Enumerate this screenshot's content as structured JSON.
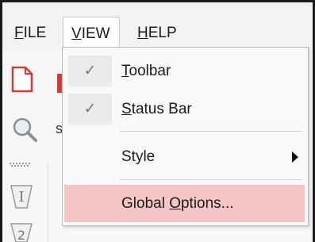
{
  "menubar": {
    "file": {
      "pre": "",
      "u": "F",
      "post": "ILE"
    },
    "view": {
      "pre": "",
      "u": "V",
      "post": "IEW"
    },
    "help": {
      "pre": "",
      "u": "H",
      "post": "ELP"
    }
  },
  "toolbar": {
    "partial_text": "s"
  },
  "view_menu": {
    "items": [
      {
        "pre": "",
        "u": "T",
        "post": "oolbar",
        "checked": true,
        "check_glyph": "✓"
      },
      {
        "pre": "",
        "u": "S",
        "post": "tatus Bar",
        "checked": true,
        "check_glyph": "✓"
      },
      {
        "pre": "Style",
        "u": "",
        "post": "",
        "submenu": true
      },
      {
        "pre": "Global ",
        "u": "O",
        "post": "ptions...",
        "highlighted": true
      }
    ]
  },
  "colors": {
    "highlight": "#f5c6c6",
    "doc_icon_accent": "#d93636"
  }
}
